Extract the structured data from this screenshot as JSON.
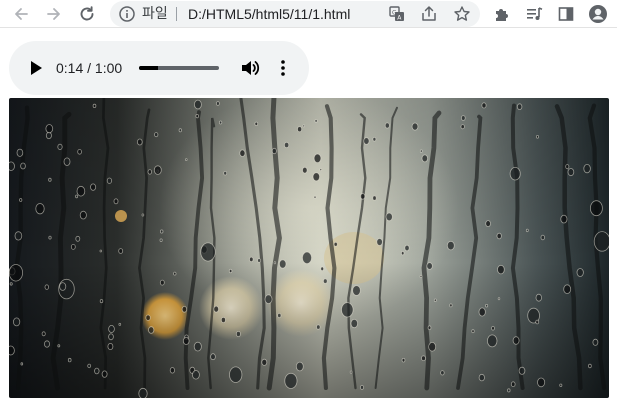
{
  "browser": {
    "nav": {
      "back_icon": "arrow-left-icon",
      "forward_icon": "arrow-right-icon",
      "reload_icon": "reload-icon"
    },
    "address_bar": {
      "scheme_label": "파일",
      "url": "D:/HTML5/html5/11/1.html"
    }
  },
  "audio": {
    "current_time": "0:14",
    "separator": "/",
    "duration": "1:00",
    "progress_fraction": 0.233
  },
  "colors": {
    "toolbar_bg": "#ffffff",
    "omnibox_bg": "#f1f3f4",
    "player_bg": "#f1f3f4",
    "icon": "#5f6368"
  }
}
